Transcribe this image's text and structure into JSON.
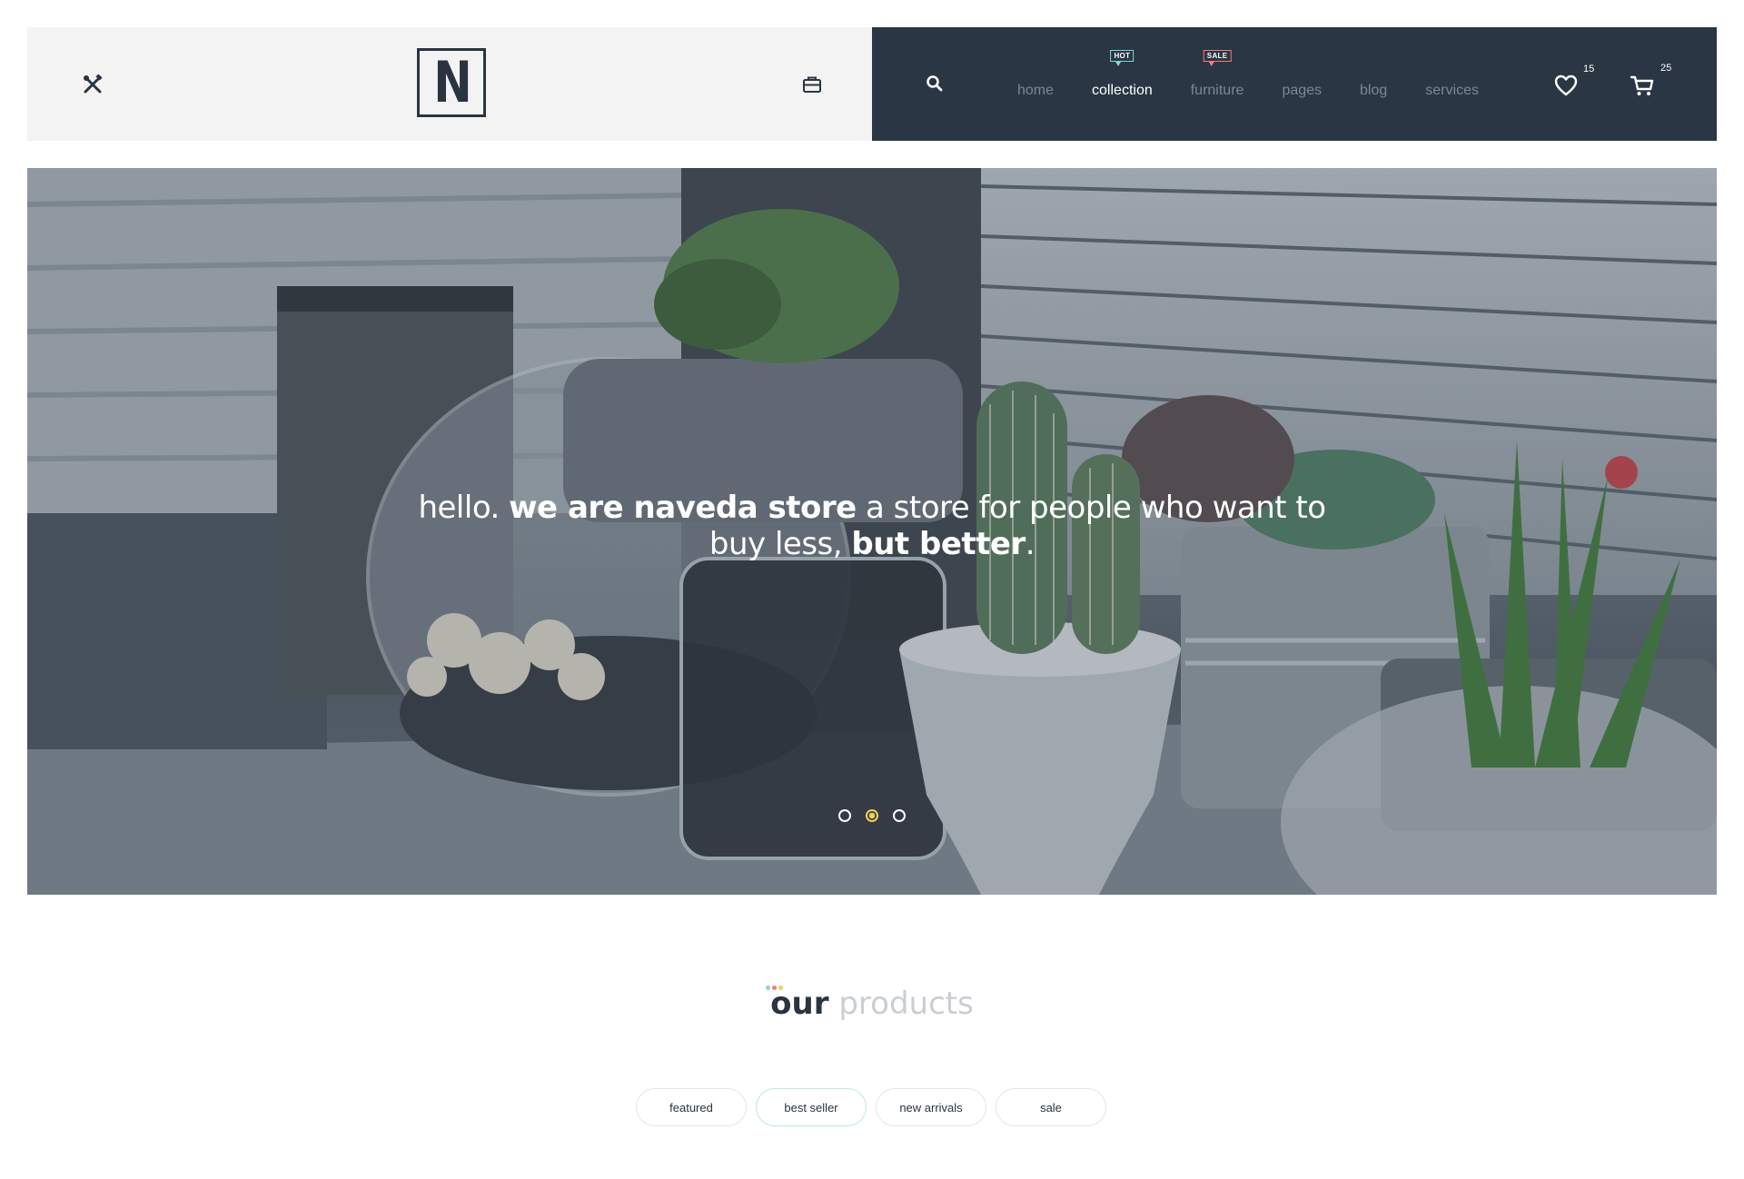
{
  "header": {
    "logo_letter": "N",
    "nav": [
      {
        "label": "home",
        "active": false,
        "badge": ""
      },
      {
        "label": "collection",
        "active": true,
        "badge": "HOT"
      },
      {
        "label": "furniture",
        "active": false,
        "badge": "SALE"
      },
      {
        "label": "pages",
        "active": false,
        "badge": ""
      },
      {
        "label": "blog",
        "active": false,
        "badge": ""
      },
      {
        "label": "services",
        "active": false,
        "badge": ""
      }
    ],
    "wishlist_count": "15",
    "cart_count": "25",
    "icons": [
      "tools-icon",
      "briefcase-icon",
      "search-icon",
      "heart-icon",
      "cart-icon"
    ]
  },
  "hero": {
    "text_part1": "hello. ",
    "text_bold1": "we are naveda store",
    "text_part2": " a store for people who want to buy less, ",
    "text_bold2": "but better",
    "text_part3": ".",
    "slides": 3,
    "active_slide": 2
  },
  "products": {
    "title_bold": "our",
    "title_light": "products",
    "filters": [
      {
        "label": "featured",
        "active": false
      },
      {
        "label": "best seller",
        "active": true
      },
      {
        "label": "new arrivals",
        "active": false
      },
      {
        "label": "sale",
        "active": false
      }
    ]
  },
  "colors": {
    "dark": "#2a3643",
    "light_bg": "#f3f3f3",
    "accent_teal": "#7fd6d1",
    "accent_red": "#f27d7d",
    "accent_yellow": "#f3d05b"
  }
}
